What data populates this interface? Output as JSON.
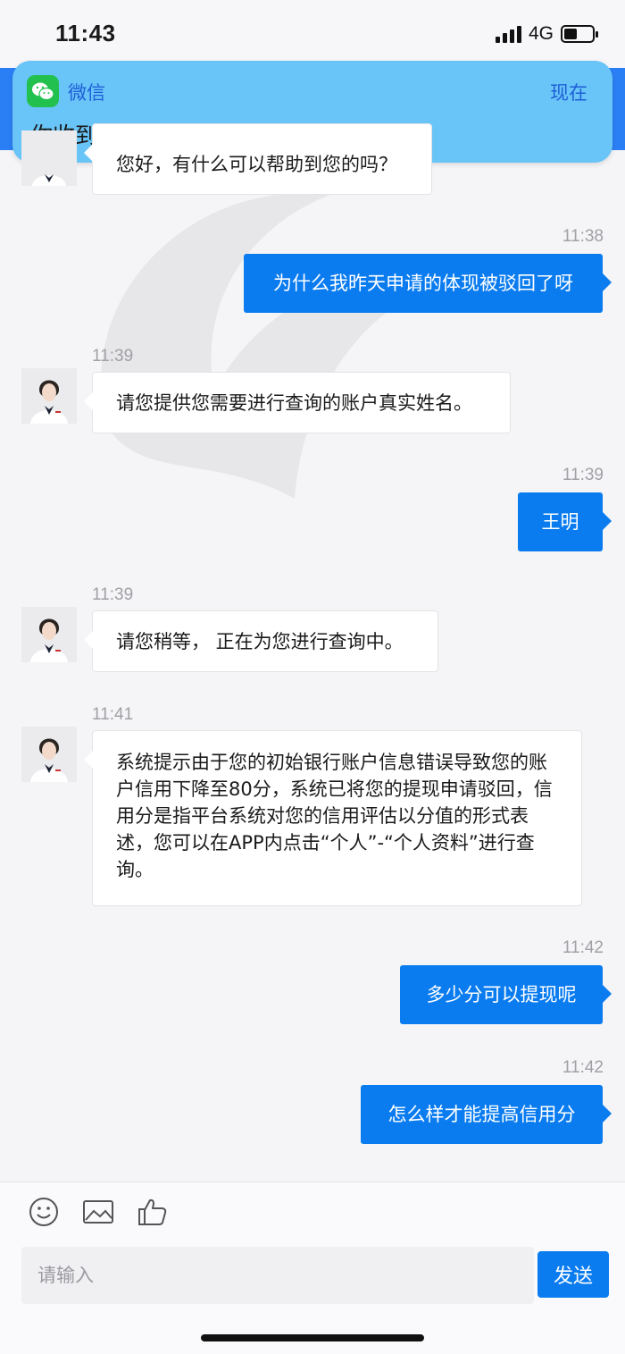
{
  "status_bar": {
    "time": "11:43",
    "network": "4G"
  },
  "notification": {
    "app_name": "微信",
    "time": "现在",
    "message": "你收到了一条微信消息"
  },
  "chat": {
    "messages": [
      {
        "sender": "agent",
        "text": "您好，有什么可以帮助到您的吗？"
      },
      {
        "sender": "user",
        "time": "11:38",
        "text": "为什么我昨天申请的体现被驳回了呀"
      },
      {
        "sender": "agent",
        "time": "11:39",
        "text": "请您提供您需要进行查询的账户真实姓名。"
      },
      {
        "sender": "user",
        "time": "11:39",
        "text": "王明"
      },
      {
        "sender": "agent",
        "time": "11:39",
        "text": "请您稍等， 正在为您进行查询中。"
      },
      {
        "sender": "agent",
        "time": "11:41",
        "text": "系统提示由于您的初始银行账户信息错误导致您的账户信用下降至80分，系统已将您的提现申请驳回，信用分是指平台系统对您的信用评估以分值的形式表述，您可以在APP内点击“个人”-“个人资料”进行查询。"
      },
      {
        "sender": "user",
        "time": "11:42",
        "text": "多少分可以提现呢"
      },
      {
        "sender": "user",
        "time": "11:42",
        "text": "怎么样才能提高信用分"
      }
    ]
  },
  "input": {
    "placeholder": "请输入",
    "send_label": "发送"
  },
  "icons": [
    "emoji-icon",
    "image-icon",
    "thumbs-up-icon",
    "wechat-icon"
  ],
  "colors": {
    "accent": "#0a7cf0",
    "notification_bg": "#69c4f8",
    "wechat_green": "#22c14f"
  }
}
